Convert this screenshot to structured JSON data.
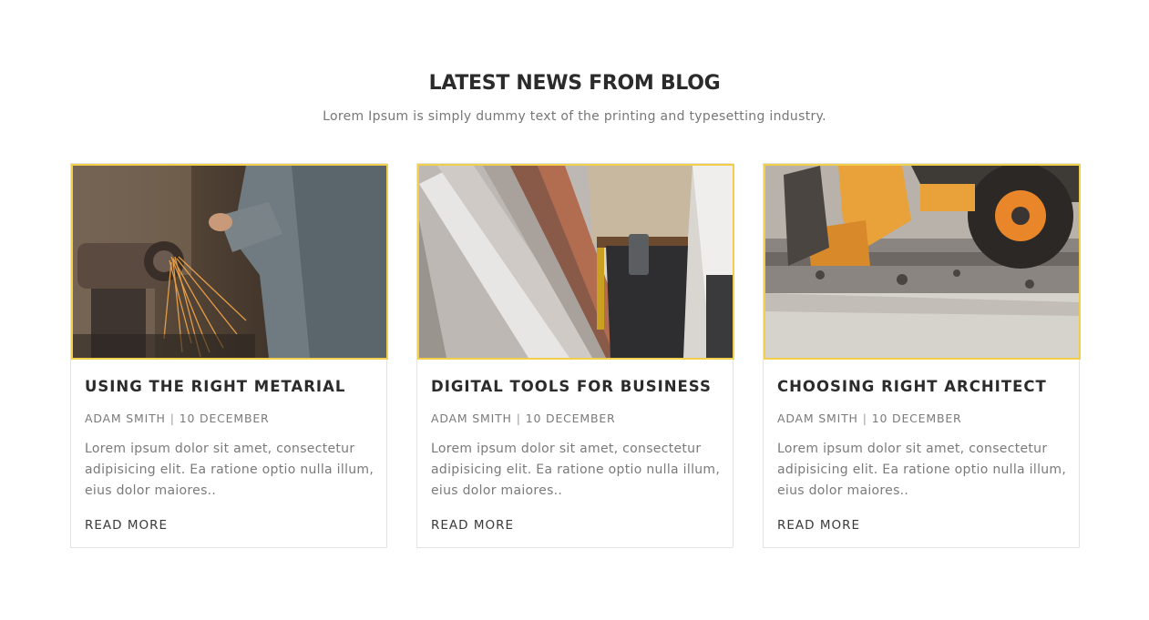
{
  "section": {
    "title": "LATEST NEWS FROM BLOG",
    "subtitle": "Lorem Ipsum is simply dummy text of the printing and typesetting industry."
  },
  "accent_color": "#f2cf4a",
  "posts": [
    {
      "image_icon": "photo-angle-grinder-sparks",
      "title": "USING THE RIGHT METARIAL",
      "author": "ADAM SMITH",
      "separator": "|",
      "date": "10 DECEMBER",
      "excerpt": "Lorem ipsum dolor sit amet, consectetur adipisicing elit. Ea ratione optio nulla illum, eius dolor maiores..",
      "read_more": "READ MORE"
    },
    {
      "image_icon": "photo-worker-tool-belt",
      "title": "DIGITAL TOOLS FOR BUSINESS",
      "author": "ADAM SMITH",
      "separator": "|",
      "date": "10 DECEMBER",
      "excerpt": "Lorem ipsum dolor sit amet, consectetur adipisicing elit. Ea ratione optio nulla illum, eius dolor maiores..",
      "read_more": "READ MORE"
    },
    {
      "image_icon": "photo-excavator-concrete",
      "title": "CHOOSING RIGHT ARCHITECT",
      "author": "ADAM SMITH",
      "separator": "|",
      "date": "10 DECEMBER",
      "excerpt": "Lorem ipsum dolor sit amet, consectetur adipisicing elit. Ea ratione optio nulla illum, eius dolor maiores..",
      "read_more": "READ MORE"
    }
  ]
}
